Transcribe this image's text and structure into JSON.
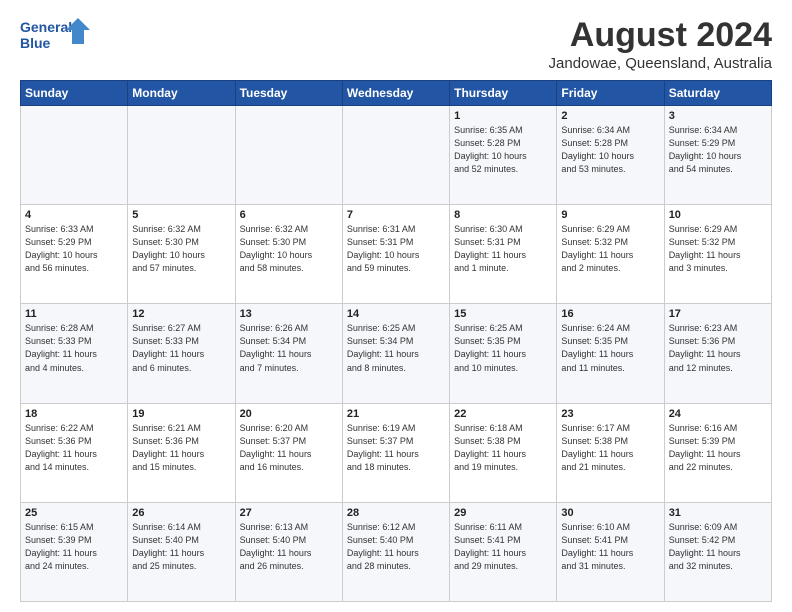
{
  "logo": {
    "line1": "General",
    "line2": "Blue"
  },
  "title": "August 2024",
  "subtitle": "Jandowae, Queensland, Australia",
  "days_of_week": [
    "Sunday",
    "Monday",
    "Tuesday",
    "Wednesday",
    "Thursday",
    "Friday",
    "Saturday"
  ],
  "weeks": [
    [
      {
        "day": "",
        "info": ""
      },
      {
        "day": "",
        "info": ""
      },
      {
        "day": "",
        "info": ""
      },
      {
        "day": "",
        "info": ""
      },
      {
        "day": "1",
        "info": "Sunrise: 6:35 AM\nSunset: 5:28 PM\nDaylight: 10 hours\nand 52 minutes."
      },
      {
        "day": "2",
        "info": "Sunrise: 6:34 AM\nSunset: 5:28 PM\nDaylight: 10 hours\nand 53 minutes."
      },
      {
        "day": "3",
        "info": "Sunrise: 6:34 AM\nSunset: 5:29 PM\nDaylight: 10 hours\nand 54 minutes."
      }
    ],
    [
      {
        "day": "4",
        "info": "Sunrise: 6:33 AM\nSunset: 5:29 PM\nDaylight: 10 hours\nand 56 minutes."
      },
      {
        "day": "5",
        "info": "Sunrise: 6:32 AM\nSunset: 5:30 PM\nDaylight: 10 hours\nand 57 minutes."
      },
      {
        "day": "6",
        "info": "Sunrise: 6:32 AM\nSunset: 5:30 PM\nDaylight: 10 hours\nand 58 minutes."
      },
      {
        "day": "7",
        "info": "Sunrise: 6:31 AM\nSunset: 5:31 PM\nDaylight: 10 hours\nand 59 minutes."
      },
      {
        "day": "8",
        "info": "Sunrise: 6:30 AM\nSunset: 5:31 PM\nDaylight: 11 hours\nand 1 minute."
      },
      {
        "day": "9",
        "info": "Sunrise: 6:29 AM\nSunset: 5:32 PM\nDaylight: 11 hours\nand 2 minutes."
      },
      {
        "day": "10",
        "info": "Sunrise: 6:29 AM\nSunset: 5:32 PM\nDaylight: 11 hours\nand 3 minutes."
      }
    ],
    [
      {
        "day": "11",
        "info": "Sunrise: 6:28 AM\nSunset: 5:33 PM\nDaylight: 11 hours\nand 4 minutes."
      },
      {
        "day": "12",
        "info": "Sunrise: 6:27 AM\nSunset: 5:33 PM\nDaylight: 11 hours\nand 6 minutes."
      },
      {
        "day": "13",
        "info": "Sunrise: 6:26 AM\nSunset: 5:34 PM\nDaylight: 11 hours\nand 7 minutes."
      },
      {
        "day": "14",
        "info": "Sunrise: 6:25 AM\nSunset: 5:34 PM\nDaylight: 11 hours\nand 8 minutes."
      },
      {
        "day": "15",
        "info": "Sunrise: 6:25 AM\nSunset: 5:35 PM\nDaylight: 11 hours\nand 10 minutes."
      },
      {
        "day": "16",
        "info": "Sunrise: 6:24 AM\nSunset: 5:35 PM\nDaylight: 11 hours\nand 11 minutes."
      },
      {
        "day": "17",
        "info": "Sunrise: 6:23 AM\nSunset: 5:36 PM\nDaylight: 11 hours\nand 12 minutes."
      }
    ],
    [
      {
        "day": "18",
        "info": "Sunrise: 6:22 AM\nSunset: 5:36 PM\nDaylight: 11 hours\nand 14 minutes."
      },
      {
        "day": "19",
        "info": "Sunrise: 6:21 AM\nSunset: 5:36 PM\nDaylight: 11 hours\nand 15 minutes."
      },
      {
        "day": "20",
        "info": "Sunrise: 6:20 AM\nSunset: 5:37 PM\nDaylight: 11 hours\nand 16 minutes."
      },
      {
        "day": "21",
        "info": "Sunrise: 6:19 AM\nSunset: 5:37 PM\nDaylight: 11 hours\nand 18 minutes."
      },
      {
        "day": "22",
        "info": "Sunrise: 6:18 AM\nSunset: 5:38 PM\nDaylight: 11 hours\nand 19 minutes."
      },
      {
        "day": "23",
        "info": "Sunrise: 6:17 AM\nSunset: 5:38 PM\nDaylight: 11 hours\nand 21 minutes."
      },
      {
        "day": "24",
        "info": "Sunrise: 6:16 AM\nSunset: 5:39 PM\nDaylight: 11 hours\nand 22 minutes."
      }
    ],
    [
      {
        "day": "25",
        "info": "Sunrise: 6:15 AM\nSunset: 5:39 PM\nDaylight: 11 hours\nand 24 minutes."
      },
      {
        "day": "26",
        "info": "Sunrise: 6:14 AM\nSunset: 5:40 PM\nDaylight: 11 hours\nand 25 minutes."
      },
      {
        "day": "27",
        "info": "Sunrise: 6:13 AM\nSunset: 5:40 PM\nDaylight: 11 hours\nand 26 minutes."
      },
      {
        "day": "28",
        "info": "Sunrise: 6:12 AM\nSunset: 5:40 PM\nDaylight: 11 hours\nand 28 minutes."
      },
      {
        "day": "29",
        "info": "Sunrise: 6:11 AM\nSunset: 5:41 PM\nDaylight: 11 hours\nand 29 minutes."
      },
      {
        "day": "30",
        "info": "Sunrise: 6:10 AM\nSunset: 5:41 PM\nDaylight: 11 hours\nand 31 minutes."
      },
      {
        "day": "31",
        "info": "Sunrise: 6:09 AM\nSunset: 5:42 PM\nDaylight: 11 hours\nand 32 minutes."
      }
    ]
  ]
}
